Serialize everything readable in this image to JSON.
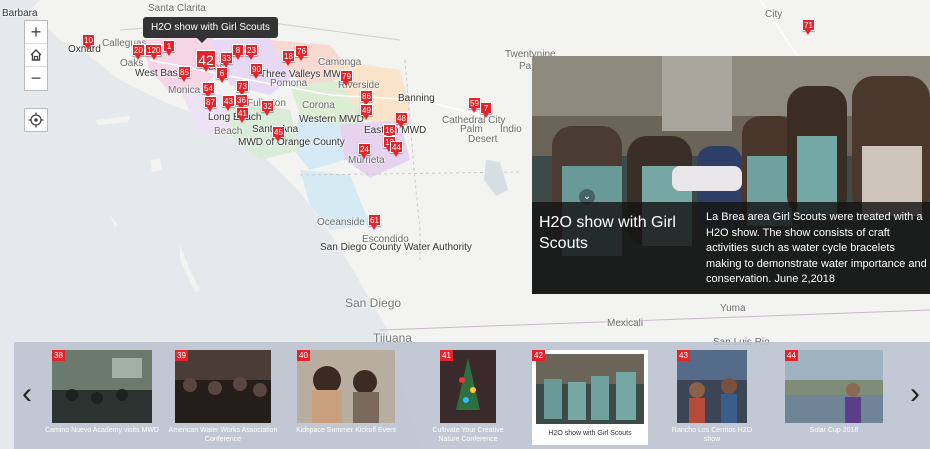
{
  "map": {
    "places": [
      "Barbara",
      "Santa Clarita",
      "Oxnard",
      "Calleguas",
      "Oaks",
      "West Basin",
      "Monica",
      "Los",
      "Fullerton",
      "Long Beach",
      "Santa Ana",
      "Beach",
      "MWD of Orange County",
      "Camonga",
      "Three Valleys MWD",
      "Pomona",
      "Corona",
      "Riverside",
      "Western MWD",
      "Banning",
      "Eastern MWD",
      "Murrieta",
      "Cathedral City",
      "Palm",
      "Indio",
      "Desert",
      "Twentynine",
      "Pa",
      "City",
      "Oceanside",
      "Escondido",
      "San Diego County Water Authority",
      "San Diego",
      "Tijuana",
      "Mexicali",
      "Yuma",
      "San Luis Rio"
    ],
    "pins": [
      "10",
      "20",
      "120",
      "85",
      "42",
      "33",
      "23",
      "8",
      "6",
      "90",
      "73",
      "54",
      "87",
      "43",
      "32",
      "36",
      "41",
      "45",
      "18",
      "76",
      "79",
      "86",
      "48",
      "49",
      "24",
      "16",
      "13",
      "44",
      "59",
      "7",
      "61",
      "71",
      "1"
    ],
    "tooltip": "H2O show with Girl Scouts"
  },
  "controls": {
    "zoom_in": "+",
    "zoom_out": "−",
    "home_icon": "home-icon",
    "locate_icon": "locate-icon"
  },
  "popup": {
    "title": "H2O show with Girl Scouts",
    "description": "La Brea area Girl Scouts were treated with a H2O show. The show consists of craft activities such as water cycle bracelets making to demonstrate water importance and conservation. June 2,2018"
  },
  "carousel": {
    "prev": "‹",
    "next": "›",
    "items": [
      {
        "num": "38",
        "label": "Camino Nuevo Academy visits MWD"
      },
      {
        "num": "39",
        "label": "American Water Works Association Conference"
      },
      {
        "num": "40",
        "label": "Kidspace Summer Kickoff Event"
      },
      {
        "num": "41",
        "label": "Cultivate Your Creative Nature Conference"
      },
      {
        "num": "42",
        "label": "H2O show with Girl Scouts"
      },
      {
        "num": "43",
        "label": "Rancho Los Cerritos H2O show"
      },
      {
        "num": "44",
        "label": "Solar Cup 2018"
      }
    ]
  },
  "colors": {
    "pin": "#e3252b",
    "popup_bg": "#222222",
    "carousel_bg": "#bcc4d0"
  }
}
